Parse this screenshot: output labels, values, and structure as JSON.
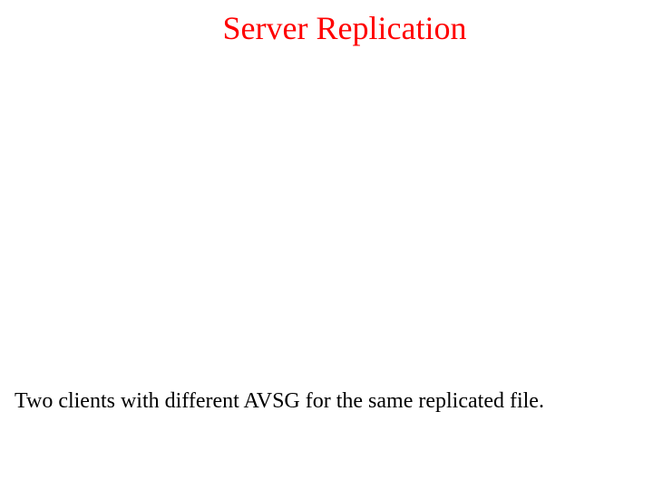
{
  "slide": {
    "title": "Server Replication",
    "caption": "Two clients with different AVSG for the same replicated file."
  }
}
